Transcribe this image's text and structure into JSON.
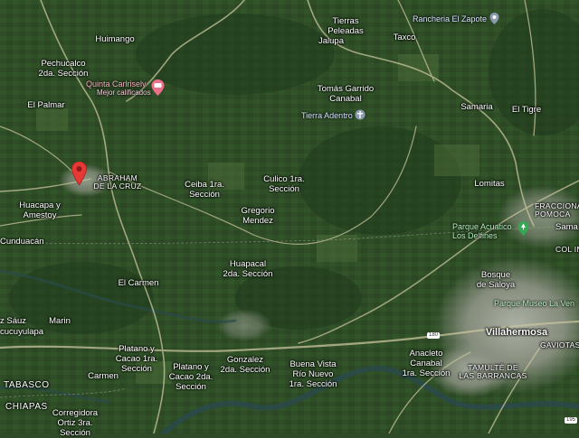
{
  "places": {
    "tierras_peleadas": "Tierras\nPeleadas",
    "jalupa": "Jalupa",
    "taxco": "Taxco",
    "ranchera_el_zapote": "Rancheria El Zapote",
    "huimango": "Huimango",
    "pechucalco": "Pechucalco\n2da. Sección",
    "quinta_carlrisely": "Quinta Carlrisely",
    "quinta_carlrisely_sub": "Mejor calificados",
    "tomas_garrido": "Tomás Garrido\nCanabal",
    "tierra_adentro": "Tierra Adentro",
    "samaria": "Samaria",
    "el_tigre": "El Tigre",
    "el_palmar": "El Palmar",
    "abraham": "ABRAHAM\nDE LA CRUZ",
    "ceiba": "Ceiba 1ra.\nSección",
    "culico": "Culico 1ra.\nSección",
    "gregorio": "Gregorio\nMendez",
    "lomitas": "Lomitas",
    "fraccionamiento": "FRACCIONAMIEN\nPOMOCA",
    "huacapa": "Huacapa y\nAmestoy",
    "parque_acuatico": "Parque Acuatico\nLos Delfines",
    "sama": "Sama",
    "cunduacan": "Cunduacán",
    "col_in": "COL IN",
    "huapacal": "Huapacal\n2da. Sección",
    "bosque": "Bosque\nde Saloya",
    "el_carmen": "El Carmen",
    "parque_museo": "Parque Museo La Ven",
    "sauz": "z Sáuz",
    "marin": "Marin",
    "cucuyulapa": "cucuyulapa",
    "villahermosa": "Villahermosa",
    "gaviotas": "GAVIOTAS",
    "platano1": "Platano y\nCacao 1ra.\nSección",
    "anacleto": "Anacleto\nCanabal\n1ra. Sección",
    "tamulte": "TAMULTÉ DE\nLAS BARRANCAS",
    "gonzalez": "Gonzalez\n2da. Sección",
    "platano2": "Platano y\nCacao 2da.\nSección",
    "buena_vista": "Buena Vista\nRío Nuevo\n1ra. Sección",
    "tabasco": "TABASCO",
    "carmen": "Carmen",
    "chiapas": "CHIAPAS",
    "corregidora": "Corregidora\nOrtiz 3ra.\nSección"
  },
  "road_badges": {
    "r180": "180",
    "r195": "195"
  },
  "colors": {
    "marker": "#e53935",
    "hotel": "#ec6f8a",
    "park": "#34a853",
    "place": "#8a9bb0"
  }
}
